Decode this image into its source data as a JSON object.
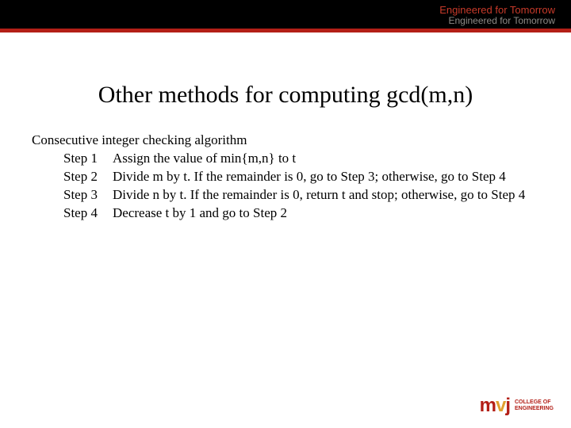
{
  "header": {
    "tagline1": "Engineered for Tomorrow",
    "tagline2": "Engineered for Tomorrow"
  },
  "title": "Other methods for computing gcd(m,n)",
  "subtitle": "Consecutive integer checking algorithm",
  "steps": {
    "s1": {
      "label": "Step 1",
      "body": "Assign the value of min{m,n} to t"
    },
    "s2": {
      "label": "Step 2",
      "body": "Divide m by t.  If the remainder is 0, go to Step 3; otherwise, go to Step 4"
    },
    "s3": {
      "label": "Step 3",
      "body": "Divide n by t.  If the remainder is 0, return t and stop; otherwise, go to Step 4"
    },
    "s4": {
      "label": "Step 4",
      "body": "Decrease t by 1 and go to Step 2"
    }
  },
  "footer": {
    "logo_text": "mvj",
    "logo_sub1": "COLLEGE OF",
    "logo_sub2": "ENGINEERING"
  }
}
